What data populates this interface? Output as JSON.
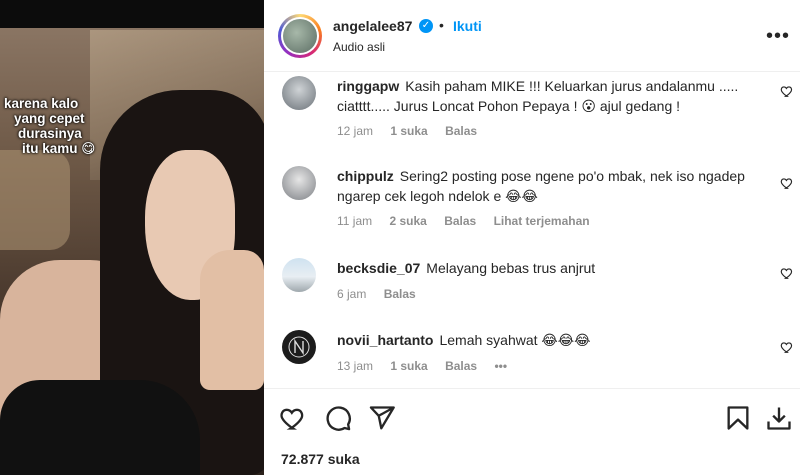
{
  "media": {
    "caption_lines": [
      "karena kalo",
      "yang cepet",
      "durasinya",
      "itu kamu 😋"
    ]
  },
  "header": {
    "username": "angelalee87",
    "verified_mark": "✓",
    "separator": "•",
    "follow_label": "Ikuti",
    "audio_label": "Audio asli",
    "more_icon": "•••"
  },
  "comments": [
    {
      "username": "ringgapw",
      "text": "Kasih paham MIKE !!! Keluarkan jurus andalanmu ..... ciatttt..... Jurus Loncat Pohon Pepaya ! 😮 ajul gedang !",
      "time": "12 jam",
      "likes": "1 suka",
      "reply": "Balas",
      "translate": ""
    },
    {
      "username": "chippulz",
      "text": "Sering2 posting pose ngene po'o mbak, nek iso ngadep ngarep cek legoh ndelok e 😂😂",
      "time": "11 jam",
      "likes": "2 suka",
      "reply": "Balas",
      "translate": "Lihat terjemahan"
    },
    {
      "username": "becksdie_07",
      "text": "Melayang bebas trus anjrut",
      "time": "6 jam",
      "likes": "",
      "reply": "Balas",
      "translate": ""
    },
    {
      "username": "novii_hartanto",
      "text": "Lemah syahwat 😂😂😂",
      "time": "13 jam",
      "likes": "1 suka",
      "reply": "Balas",
      "translate": "•••"
    }
  ],
  "actions": {
    "likes_count": "72.877 suka"
  },
  "colors": {
    "accent": "#0095f6",
    "text": "#262626",
    "muted": "#8e8e8e"
  }
}
